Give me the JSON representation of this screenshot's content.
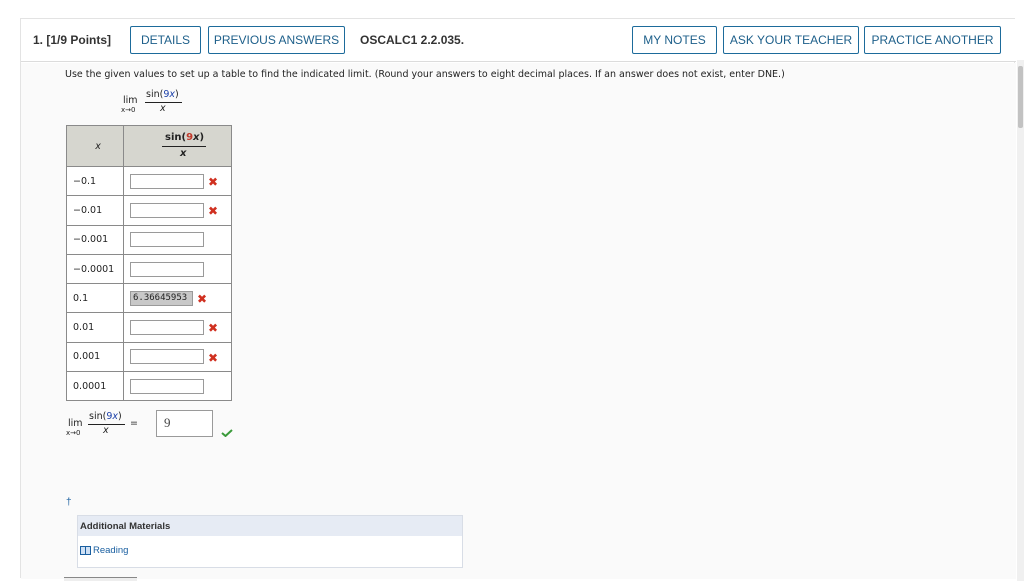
{
  "header": {
    "question_label": "1. [1/9 Points]",
    "details": "DETAILS",
    "previous_answers": "PREVIOUS ANSWERS",
    "assignment_code": "OSCALC1 2.2.035.",
    "my_notes": "MY NOTES",
    "ask_teacher": "ASK YOUR TEACHER",
    "practice_another": "PRACTICE ANOTHER"
  },
  "question": {
    "prompt": "Use the given values to set up a table to find the indicated limit. (Round your answers to eight decimal places. If an answer does not exist, enter DNE.)",
    "limit": {
      "lim": "lim",
      "approach": "x→0",
      "numerator_fn": "sin(",
      "numerator_coef": "9",
      "numerator_var": "x",
      "numerator_close": ")",
      "denominator": "x"
    }
  },
  "table": {
    "col_x_header": "x",
    "col_f_header_num": "sin(9x)",
    "col_f_header_den": "x",
    "rows": [
      {
        "x": "−0.1",
        "answer": "",
        "mark": "✖"
      },
      {
        "x": "−0.01",
        "answer": "",
        "mark": "✖"
      },
      {
        "x": "−0.001",
        "answer": "",
        "mark": ""
      },
      {
        "x": "−0.0001",
        "answer": "",
        "mark": ""
      },
      {
        "x": "0.1",
        "answer": "6.36645953",
        "mark": "✖"
      },
      {
        "x": "0.01",
        "answer": "",
        "mark": "✖"
      },
      {
        "x": "0.001",
        "answer": "",
        "mark": "✖"
      },
      {
        "x": "0.0001",
        "answer": "",
        "mark": ""
      }
    ]
  },
  "final": {
    "lim": "lim",
    "approach": "x→0",
    "num_fn": "sin(",
    "num_coef": "9",
    "num_var": "x",
    "num_close": ")",
    "den": "x",
    "equals": "=",
    "answer": "9"
  },
  "footnote": {
    "dagger": "†"
  },
  "additional_materials": {
    "title": "Additional Materials",
    "reading": "Reading"
  },
  "colors": {
    "button_border": "#1d6b9b",
    "button_text": "#1d5f8a",
    "wrong": "#d03020",
    "correct": "#3a9a3a",
    "coef_blue": "#1a3fa8"
  }
}
